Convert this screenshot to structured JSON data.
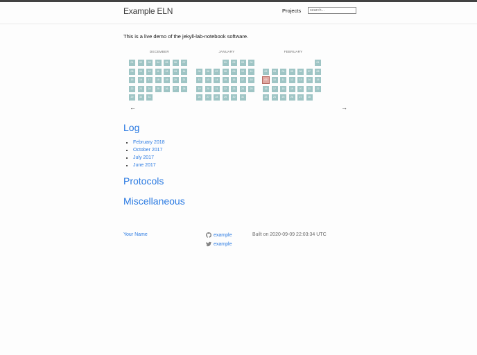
{
  "header": {
    "site_title": "Example ELN",
    "nav_projects": "Projects",
    "search_placeholder": "search..."
  },
  "intro": "This is a live demo of the jekyll-lab-notebook software.",
  "calendar": {
    "months": [
      {
        "name": "DECEMBER",
        "offset": 0,
        "days": 31,
        "active": null
      },
      {
        "name": "JANUARY",
        "offset": 3,
        "days": 31,
        "active": null
      },
      {
        "name": "FEBRUARY",
        "offset": 6,
        "days": 28,
        "active": 9
      }
    ],
    "prev_arrow": "←",
    "next_arrow": "→"
  },
  "sections": {
    "log_title": "Log",
    "protocols_title": "Protocols",
    "misc_title": "Miscellaneous"
  },
  "log_items": [
    "February 2018",
    "October 2017",
    "July 2017",
    "June 2017"
  ],
  "footer": {
    "name": "Your Name",
    "github": "example",
    "twitter": "example",
    "built": "Built on 2020-09-09 22:03:34 UTC"
  },
  "colors": {
    "link": "#2a7ae2",
    "calendar_day": "#9fc5c5",
    "calendar_active": "#e0a8a2"
  }
}
